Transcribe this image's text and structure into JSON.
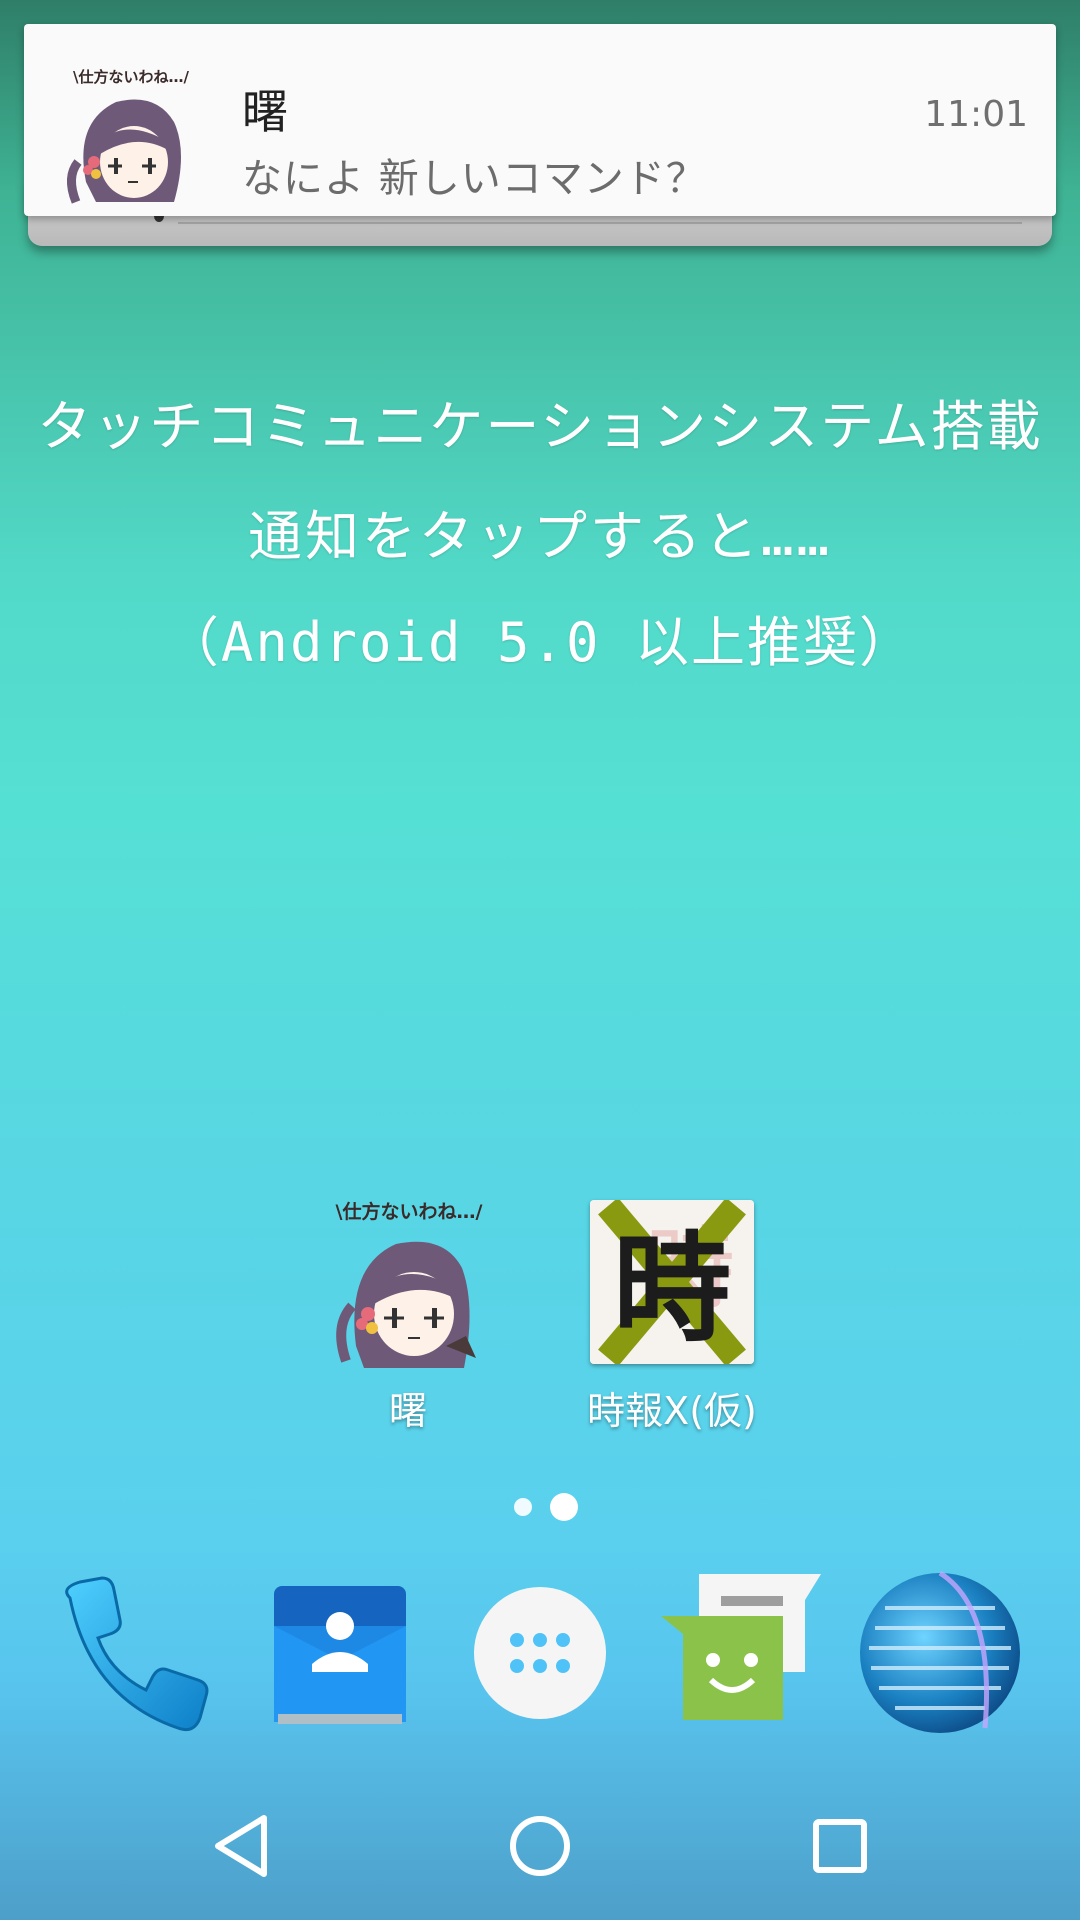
{
  "notification": {
    "title": "曙",
    "body": "なによ 新しいコマンド？",
    "time": "11:01",
    "avatar_icon": "akebono-chibi-icon",
    "avatar_banner": "\\仕方ないわね…/"
  },
  "captions": {
    "line1": "タッチコミュニケーションシステム搭載",
    "line2": "通知をタップすると……",
    "line3": "（Android 5.0 以上推奨）"
  },
  "shortcuts": [
    {
      "label": "曙",
      "icon": "akebono-chibi-icon",
      "banner": "\\仕方ないわね…/"
    },
    {
      "label": "時報X(仮)",
      "icon": "jiho-x-icon",
      "glyph": "時"
    }
  ],
  "page_indicator": {
    "pages": 2,
    "current": 2
  },
  "dock": [
    {
      "name": "phone",
      "icon": "phone-icon",
      "color": "#1a9ee0"
    },
    {
      "name": "contacts",
      "icon": "contacts-icon",
      "color": "#1e88e5"
    },
    {
      "name": "all-apps",
      "icon": "app-drawer-icon",
      "color": "#4fc3f7"
    },
    {
      "name": "messages",
      "icon": "messages-icon",
      "color": "#8bc34a"
    },
    {
      "name": "browser",
      "icon": "globe-icon",
      "color": "#1976d2"
    }
  ],
  "navigation": [
    "back",
    "home",
    "recents"
  ]
}
